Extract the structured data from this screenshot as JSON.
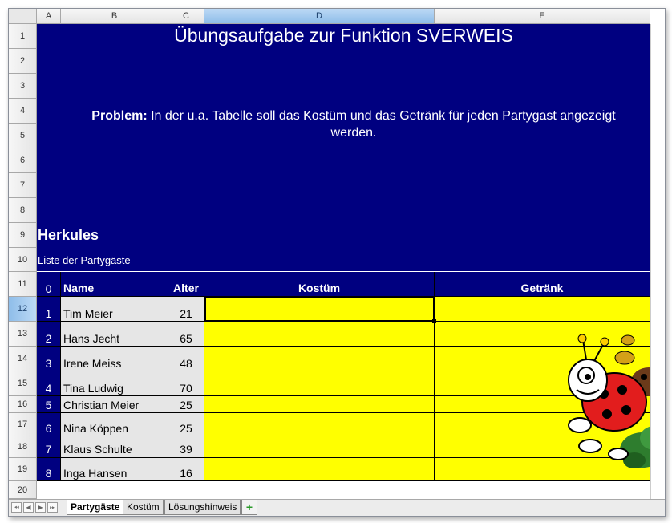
{
  "columns": [
    "A",
    "B",
    "C",
    "D",
    "E"
  ],
  "rows": [
    "1",
    "2",
    "3",
    "4",
    "5",
    "6",
    "7",
    "8",
    "9",
    "10",
    "11",
    "12",
    "13",
    "14",
    "15",
    "16",
    "17",
    "18",
    "19",
    "20"
  ],
  "title": "Übungsaufgabe zur Funktion SVERWEIS",
  "problem": {
    "label": "Problem:",
    "text": " In der u.a. Tabelle soll das Kostüm und das Getränk für jeden Partygast angezeigt werden."
  },
  "company": "Herkules",
  "list_title": "Liste der Partygäste",
  "table": {
    "headers": {
      "nr": "0",
      "name": "Name",
      "age": "Alter",
      "costume": "Kostüm",
      "drink": "Getränk"
    },
    "guests": [
      {
        "nr": "1",
        "name": "Tim Meier",
        "age": "21"
      },
      {
        "nr": "2",
        "name": "Hans Jecht",
        "age": "65"
      },
      {
        "nr": "3",
        "name": "Irene Meiss",
        "age": "48"
      },
      {
        "nr": "4",
        "name": "Tina Ludwig",
        "age": "70"
      },
      {
        "nr": "5",
        "name": "Christian Meier",
        "age": "25"
      },
      {
        "nr": "6",
        "name": "Nina Köppen",
        "age": "25"
      },
      {
        "nr": "7",
        "name": "Klaus Schulte",
        "age": "39"
      },
      {
        "nr": "8",
        "name": "Inga Hansen",
        "age": "16"
      }
    ]
  },
  "sheet_tabs": [
    "Partygäste",
    "Kostüm",
    "Lösungshinweis"
  ],
  "active_sheet": "Partygäste",
  "colors": {
    "header_bg": "#000080",
    "fill_yellow": "#ffff00",
    "name_bg": "#e6e6e6"
  }
}
